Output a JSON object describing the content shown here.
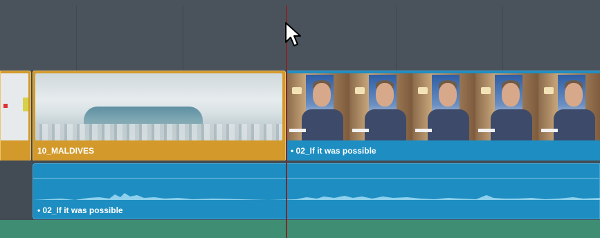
{
  "timeline": {
    "clips": [
      {
        "label": "10_MALDIVES",
        "color": "#d39a2b",
        "type": "video"
      },
      {
        "label": "• 02_If it was possible",
        "color": "#1e8ec2",
        "type": "video"
      },
      {
        "label": "• 02_If it was possible",
        "color": "#1e8ec2",
        "type": "audio"
      }
    ],
    "playhead_color": "#7a2a2a",
    "track_colors": {
      "empty": "#4a535c",
      "audio_track_below": "#3f8d72"
    }
  }
}
